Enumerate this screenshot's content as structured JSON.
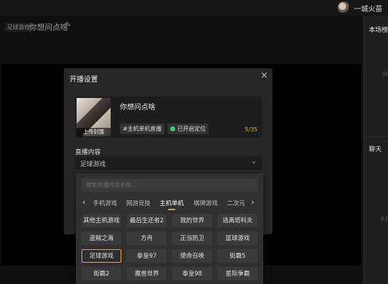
{
  "topbar": {
    "username": "一城火苗"
  },
  "stream": {
    "category_tag": "足球游戏",
    "title": "你想问点啥"
  },
  "right_panel": {
    "section1_title": "本场榜",
    "section1_dim": "开",
    "section2_title": "聊天",
    "section2_dim": "本场"
  },
  "dialog": {
    "title": "开播设置",
    "close": "×",
    "cover_label": "上传封面",
    "room_title": "你想问点啥",
    "tag_chip": "#主机单机直播",
    "location_chip": "已开启定位",
    "title_counter": "5/35",
    "content_label": "直播内容",
    "select_value": "足球游戏",
    "select_chevron": "⌄"
  },
  "dropdown": {
    "search_placeholder": "搜索直播内容名称...",
    "prev_arrow": "‹",
    "next_arrow": "›",
    "tabs": [
      {
        "label": "手机游戏",
        "active": false
      },
      {
        "label": "网游竞技",
        "active": false
      },
      {
        "label": "主机单机",
        "active": true
      },
      {
        "label": "棋牌游戏",
        "active": false
      },
      {
        "label": "二次元",
        "active": false
      }
    ],
    "games": [
      [
        "其他主机游戏",
        "最后生还者2",
        "我的世界",
        "逃离塔科夫"
      ],
      [
        "盗贼之海",
        "方舟",
        "正当防卫",
        "篮球游戏"
      ],
      [
        "足球游戏",
        "拳皇97",
        "使命召唤",
        "街霸5"
      ],
      [
        "街霸2",
        "魔兽世界",
        "拳皇98",
        "星际争霸"
      ]
    ],
    "selected_game": "足球游戏"
  },
  "colors": {
    "accent": "#e8a53b",
    "location_green": "#3ccf74",
    "dialog_bg": "#262626",
    "page_bg": "#141414"
  },
  "icons": {
    "edit": "edit-icon",
    "close": "close-icon",
    "chevron": "chevron-down-icon",
    "location": "location-dot-icon",
    "arrows": [
      "chevron-left-icon",
      "chevron-right-icon"
    ]
  }
}
